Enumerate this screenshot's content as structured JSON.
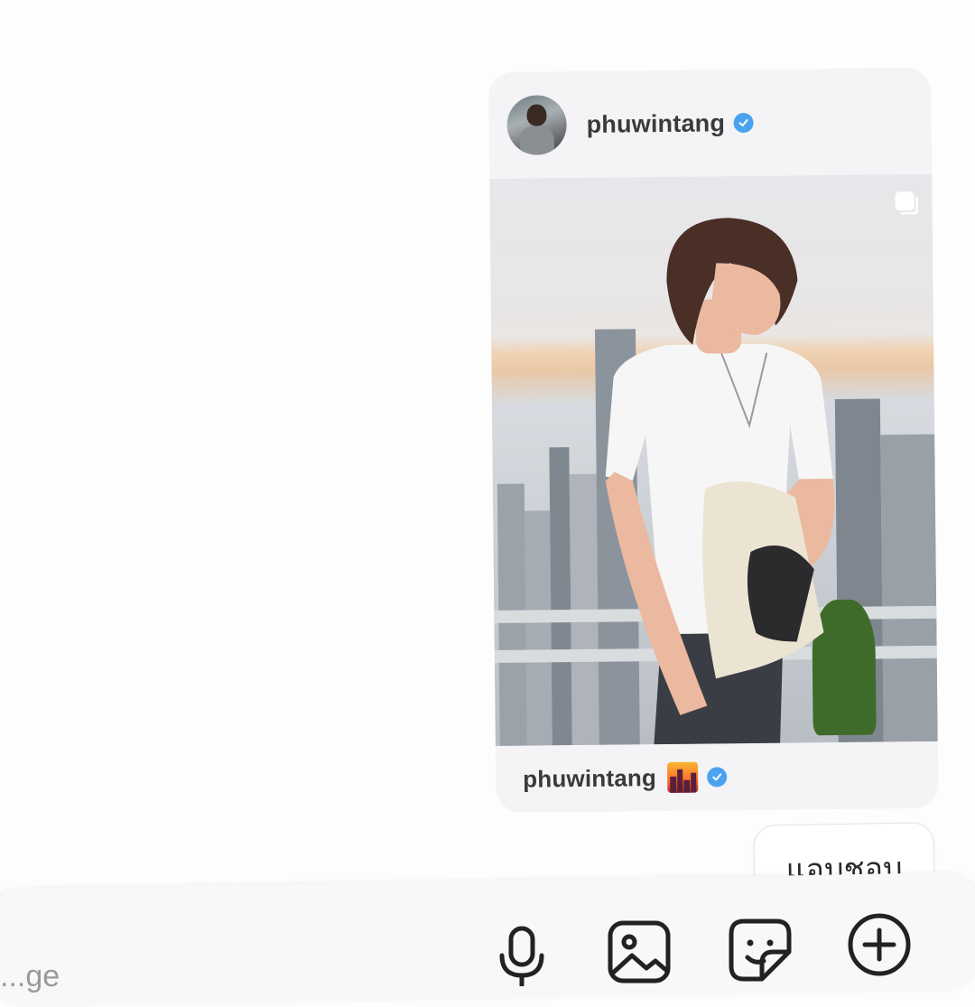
{
  "shared_post": {
    "username": "phuwintang",
    "caption_username": "phuwintang",
    "verified_icon": "verified-badge-icon",
    "carousel_icon": "multi-image-icon",
    "caption_emoji": "🌇",
    "badge_color": "#4aa3f0"
  },
  "messages": [
    {
      "text": "แอบชอบ",
      "direction": "outgoing"
    }
  ],
  "composer": {
    "placeholder": "...ge",
    "icons": [
      "microphone-icon",
      "gallery-icon",
      "sticker-icon",
      "add-icon"
    ]
  }
}
